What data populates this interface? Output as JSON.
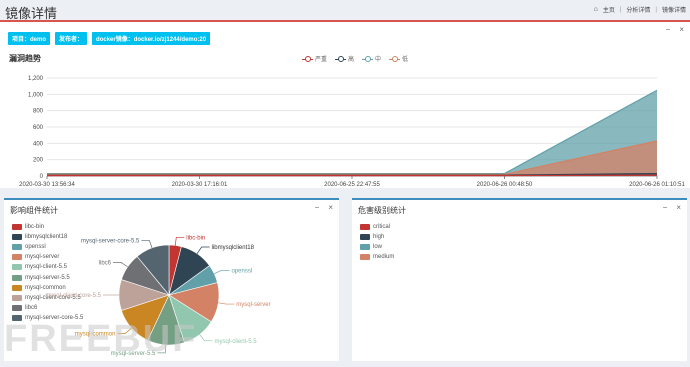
{
  "header": {
    "title": "镜像详情",
    "breadcrumb": [
      "主页",
      "分析详情",
      "镜像详情"
    ]
  },
  "tags": [
    "项目：demo",
    "发布者：",
    "docker镜像：docker.io/zj1244/demo:20"
  ],
  "trend": {
    "title": "漏洞趋势",
    "legend": [
      "严重",
      "高",
      "中",
      "低"
    ],
    "colors": [
      "#c23531",
      "#2f4554",
      "#61a0a8",
      "#d48265"
    ],
    "chart_data": {
      "type": "area",
      "categories": [
        "2020-03-30 13:56:34",
        "2020-03-30 17:16:01",
        "2020-06-25 22:47:55",
        "2020-06-26 00:48:50",
        "2020-06-26 01:10:51"
      ],
      "series": [
        {
          "name": "严重",
          "values": [
            5,
            5,
            5,
            5,
            10
          ]
        },
        {
          "name": "高",
          "values": [
            10,
            10,
            10,
            10,
            30
          ]
        },
        {
          "name": "中",
          "values": [
            30,
            30,
            30,
            30,
            1050
          ]
        },
        {
          "name": "低",
          "values": [
            20,
            20,
            20,
            20,
            430
          ]
        }
      ],
      "yticks": [
        0,
        200,
        400,
        600,
        800,
        1000,
        1200
      ],
      "ylim": [
        0,
        1200
      ]
    }
  },
  "components": {
    "title": "影响组件统计",
    "colors": [
      "#c23531",
      "#2f4554",
      "#61a0a8",
      "#d48265",
      "#91c7ae",
      "#749f83",
      "#ca8622",
      "#bda29a",
      "#6e7074",
      "#546570"
    ],
    "chart_data": {
      "type": "pie",
      "labels": [
        "libc-bin",
        "libmysqlclient18",
        "openssl",
        "mysql-server",
        "mysql-client-5.5",
        "mysql-server-5.5",
        "mysql-common",
        "mysql-client-core-5.5",
        "libc6",
        "mysql-server-core-5.5"
      ],
      "values": [
        4,
        11,
        6,
        13,
        11,
        12,
        13,
        10,
        9,
        11
      ]
    }
  },
  "severity": {
    "title": "危害级别统计",
    "colors": [
      "#c23531",
      "#2f4554",
      "#61a0a8",
      "#d48265"
    ],
    "chart_data": {
      "type": "pie",
      "labels": [
        "critical",
        "high",
        "low",
        "medium"
      ],
      "values": [
        1,
        6,
        185,
        640
      ]
    }
  },
  "watermark": "FREEBUF"
}
